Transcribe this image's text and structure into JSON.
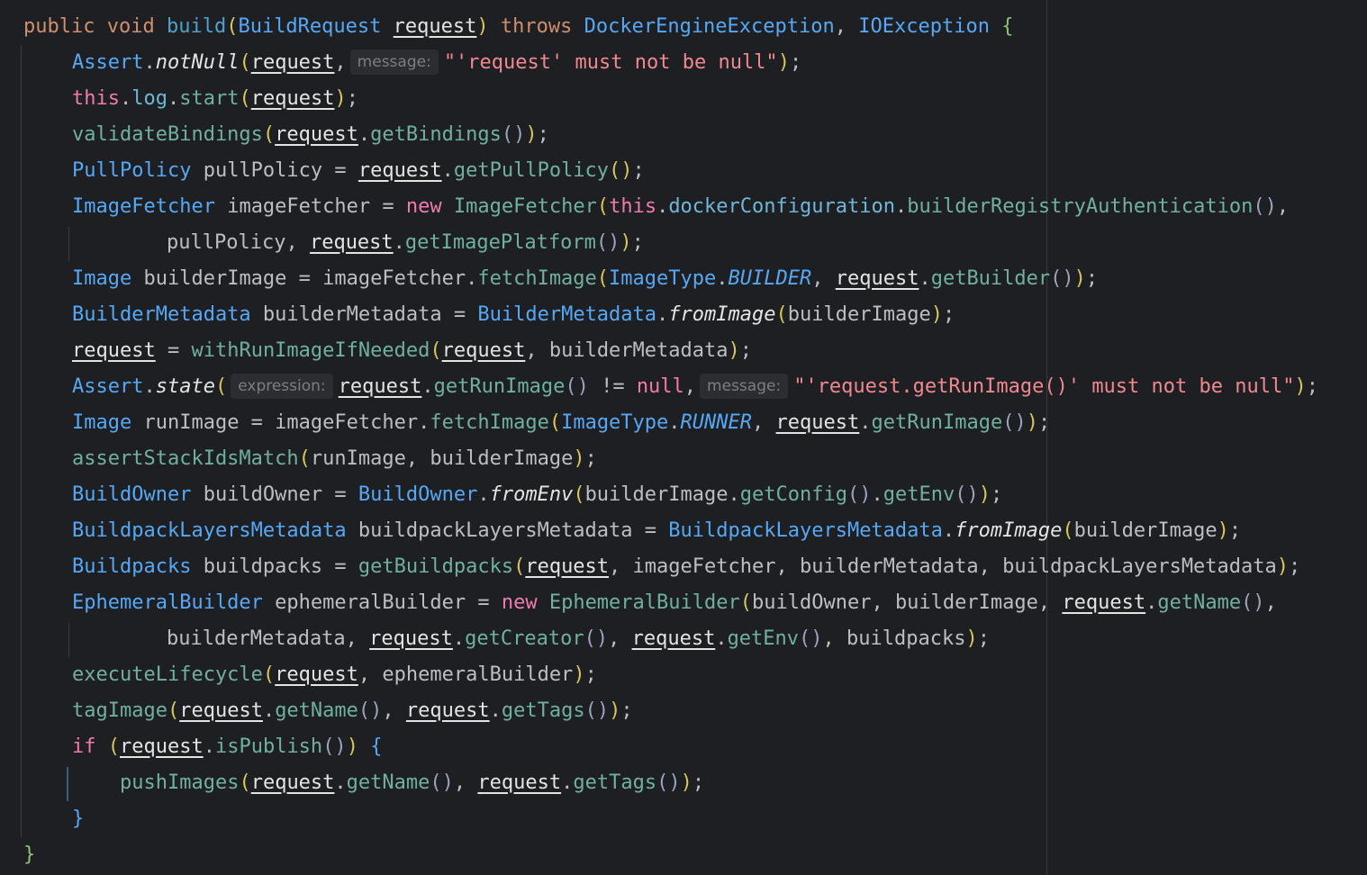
{
  "editor": {
    "lines": [
      [
        {
          "t": "public",
          "c": "kw"
        },
        {
          "t": " ",
          "c": "punc"
        },
        {
          "t": "void",
          "c": "kw"
        },
        {
          "t": " ",
          "c": "punc"
        },
        {
          "t": "build",
          "c": "mdecl"
        },
        {
          "t": "(",
          "c": "paren"
        },
        {
          "t": "BuildRequest",
          "c": "type"
        },
        {
          "t": " ",
          "c": "punc"
        },
        {
          "t": "request",
          "c": "param"
        },
        {
          "t": ")",
          "c": "paren"
        },
        {
          "t": " ",
          "c": "punc"
        },
        {
          "t": "throws",
          "c": "kw"
        },
        {
          "t": " ",
          "c": "punc"
        },
        {
          "t": "DockerEngineException",
          "c": "type"
        },
        {
          "t": ", ",
          "c": "punc"
        },
        {
          "t": "IOException",
          "c": "type"
        },
        {
          "t": " ",
          "c": "punc"
        },
        {
          "t": "{",
          "c": "brace2"
        }
      ],
      [
        {
          "t": "Assert",
          "c": "type"
        },
        {
          "t": ".",
          "c": "punc"
        },
        {
          "t": "notNull",
          "c": "smeth"
        },
        {
          "t": "(",
          "c": "paren"
        },
        {
          "t": "request",
          "c": "param"
        },
        {
          "t": ",",
          "c": "punc"
        },
        {
          "t": "message:",
          "c": "hint"
        },
        {
          "t": "\"'request' must not be null\"",
          "c": "str"
        },
        {
          "t": ")",
          "c": "paren"
        },
        {
          "t": ";",
          "c": "punc"
        }
      ],
      [
        {
          "t": "this",
          "c": "pkw"
        },
        {
          "t": ".",
          "c": "punc"
        },
        {
          "t": "log",
          "c": "field"
        },
        {
          "t": ".",
          "c": "punc"
        },
        {
          "t": "start",
          "c": "meth"
        },
        {
          "t": "(",
          "c": "paren"
        },
        {
          "t": "request",
          "c": "param"
        },
        {
          "t": ")",
          "c": "paren"
        },
        {
          "t": ";",
          "c": "punc"
        }
      ],
      [
        {
          "t": "validateBindings",
          "c": "meth"
        },
        {
          "t": "(",
          "c": "paren"
        },
        {
          "t": "request",
          "c": "param"
        },
        {
          "t": ".",
          "c": "punc"
        },
        {
          "t": "getBindings",
          "c": "meth"
        },
        {
          "t": "()",
          "c": "paren2"
        },
        {
          "t": ")",
          "c": "paren"
        },
        {
          "t": ";",
          "c": "punc"
        }
      ],
      [
        {
          "t": "PullPolicy",
          "c": "type"
        },
        {
          "t": " pullPolicy = ",
          "c": "var"
        },
        {
          "t": "request",
          "c": "param"
        },
        {
          "t": ".",
          "c": "punc"
        },
        {
          "t": "getPullPolicy",
          "c": "meth"
        },
        {
          "t": "()",
          "c": "paren"
        },
        {
          "t": ";",
          "c": "punc"
        }
      ],
      [
        {
          "t": "ImageFetcher",
          "c": "type"
        },
        {
          "t": " imageFetcher = ",
          "c": "var"
        },
        {
          "t": "new",
          "c": "pkw"
        },
        {
          "t": " ",
          "c": "punc"
        },
        {
          "t": "ImageFetcher",
          "c": "meth"
        },
        {
          "t": "(",
          "c": "paren"
        },
        {
          "t": "this",
          "c": "pkw"
        },
        {
          "t": ".",
          "c": "punc"
        },
        {
          "t": "dockerConfiguration",
          "c": "field"
        },
        {
          "t": ".",
          "c": "punc"
        },
        {
          "t": "builderRegistryAuthentication",
          "c": "meth"
        },
        {
          "t": "()",
          "c": "paren2"
        },
        {
          "t": ",",
          "c": "punc"
        }
      ],
      [
        {
          "t": "pullPolicy, ",
          "c": "var"
        },
        {
          "t": "request",
          "c": "param"
        },
        {
          "t": ".",
          "c": "punc"
        },
        {
          "t": "getImagePlatform",
          "c": "meth"
        },
        {
          "t": "()",
          "c": "paren2"
        },
        {
          "t": ")",
          "c": "paren"
        },
        {
          "t": ";",
          "c": "punc"
        }
      ],
      [
        {
          "t": "Image",
          "c": "type"
        },
        {
          "t": " builderImage = imageFetcher.",
          "c": "var"
        },
        {
          "t": "fetchImage",
          "c": "meth"
        },
        {
          "t": "(",
          "c": "paren"
        },
        {
          "t": "ImageType",
          "c": "type"
        },
        {
          "t": ".",
          "c": "punc"
        },
        {
          "t": "BUILDER",
          "c": "static"
        },
        {
          "t": ", ",
          "c": "punc"
        },
        {
          "t": "request",
          "c": "param"
        },
        {
          "t": ".",
          "c": "punc"
        },
        {
          "t": "getBuilder",
          "c": "meth"
        },
        {
          "t": "()",
          "c": "paren2"
        },
        {
          "t": ")",
          "c": "paren"
        },
        {
          "t": ";",
          "c": "punc"
        }
      ],
      [
        {
          "t": "BuilderMetadata",
          "c": "type"
        },
        {
          "t": " builderMetadata = ",
          "c": "var"
        },
        {
          "t": "BuilderMetadata",
          "c": "type"
        },
        {
          "t": ".",
          "c": "punc"
        },
        {
          "t": "fromImage",
          "c": "smeth"
        },
        {
          "t": "(",
          "c": "paren"
        },
        {
          "t": "builderImage",
          "c": "var"
        },
        {
          "t": ")",
          "c": "paren"
        },
        {
          "t": ";",
          "c": "punc"
        }
      ],
      [
        {
          "t": "request",
          "c": "param"
        },
        {
          "t": " = ",
          "c": "var"
        },
        {
          "t": "withRunImageIfNeeded",
          "c": "meth"
        },
        {
          "t": "(",
          "c": "paren"
        },
        {
          "t": "request",
          "c": "param"
        },
        {
          "t": ", builderMetadata",
          "c": "var"
        },
        {
          "t": ")",
          "c": "paren"
        },
        {
          "t": ";",
          "c": "punc"
        }
      ],
      [
        {
          "t": "Assert",
          "c": "type"
        },
        {
          "t": ".",
          "c": "punc"
        },
        {
          "t": "state",
          "c": "smeth"
        },
        {
          "t": "(",
          "c": "paren"
        },
        {
          "t": "expression:",
          "c": "hint"
        },
        {
          "t": "request",
          "c": "param"
        },
        {
          "t": ".",
          "c": "punc"
        },
        {
          "t": "getRunImage",
          "c": "meth"
        },
        {
          "t": "()",
          "c": "paren2"
        },
        {
          "t": " != ",
          "c": "var"
        },
        {
          "t": "null",
          "c": "pkw"
        },
        {
          "t": ",",
          "c": "punc"
        },
        {
          "t": "message:",
          "c": "hint"
        },
        {
          "t": "\"'request.getRunImage()' must not be null\"",
          "c": "str"
        },
        {
          "t": ")",
          "c": "paren"
        },
        {
          "t": ";",
          "c": "punc"
        }
      ],
      [
        {
          "t": "Image",
          "c": "type"
        },
        {
          "t": " runImage = imageFetcher.",
          "c": "var"
        },
        {
          "t": "fetchImage",
          "c": "meth"
        },
        {
          "t": "(",
          "c": "paren"
        },
        {
          "t": "ImageType",
          "c": "type"
        },
        {
          "t": ".",
          "c": "punc"
        },
        {
          "t": "RUNNER",
          "c": "static"
        },
        {
          "t": ", ",
          "c": "punc"
        },
        {
          "t": "request",
          "c": "param"
        },
        {
          "t": ".",
          "c": "punc"
        },
        {
          "t": "getRunImage",
          "c": "meth"
        },
        {
          "t": "()",
          "c": "paren2"
        },
        {
          "t": ")",
          "c": "paren"
        },
        {
          "t": ";",
          "c": "punc"
        }
      ],
      [
        {
          "t": "assertStackIdsMatch",
          "c": "meth"
        },
        {
          "t": "(",
          "c": "paren"
        },
        {
          "t": "runImage, builderImage",
          "c": "var"
        },
        {
          "t": ")",
          "c": "paren"
        },
        {
          "t": ";",
          "c": "punc"
        }
      ],
      [
        {
          "t": "BuildOwner",
          "c": "type"
        },
        {
          "t": " buildOwner = ",
          "c": "var"
        },
        {
          "t": "BuildOwner",
          "c": "type"
        },
        {
          "t": ".",
          "c": "punc"
        },
        {
          "t": "fromEnv",
          "c": "smeth"
        },
        {
          "t": "(",
          "c": "paren"
        },
        {
          "t": "builderImage.",
          "c": "var"
        },
        {
          "t": "getConfig",
          "c": "meth"
        },
        {
          "t": "()",
          "c": "paren2"
        },
        {
          "t": ".",
          "c": "punc"
        },
        {
          "t": "getEnv",
          "c": "meth"
        },
        {
          "t": "()",
          "c": "paren2"
        },
        {
          "t": ")",
          "c": "paren"
        },
        {
          "t": ";",
          "c": "punc"
        }
      ],
      [
        {
          "t": "BuildpackLayersMetadata",
          "c": "type"
        },
        {
          "t": " buildpackLayersMetadata = ",
          "c": "var"
        },
        {
          "t": "BuildpackLayersMetadata",
          "c": "type"
        },
        {
          "t": ".",
          "c": "punc"
        },
        {
          "t": "fromImage",
          "c": "smeth"
        },
        {
          "t": "(",
          "c": "paren"
        },
        {
          "t": "builderImage",
          "c": "var"
        },
        {
          "t": ")",
          "c": "paren"
        },
        {
          "t": ";",
          "c": "punc"
        }
      ],
      [
        {
          "t": "Buildpacks",
          "c": "type"
        },
        {
          "t": " buildpacks = ",
          "c": "var"
        },
        {
          "t": "getBuildpacks",
          "c": "meth"
        },
        {
          "t": "(",
          "c": "paren"
        },
        {
          "t": "request",
          "c": "param"
        },
        {
          "t": ", imageFetcher, builderMetadata, buildpackLayersMetadata",
          "c": "var"
        },
        {
          "t": ")",
          "c": "paren"
        },
        {
          "t": ";",
          "c": "punc"
        }
      ],
      [
        {
          "t": "EphemeralBuilder",
          "c": "type"
        },
        {
          "t": " ephemeralBuilder = ",
          "c": "var"
        },
        {
          "t": "new",
          "c": "pkw"
        },
        {
          "t": " ",
          "c": "punc"
        },
        {
          "t": "EphemeralBuilder",
          "c": "meth"
        },
        {
          "t": "(",
          "c": "paren"
        },
        {
          "t": "buildOwner, builderImage, ",
          "c": "var"
        },
        {
          "t": "request",
          "c": "param"
        },
        {
          "t": ".",
          "c": "punc"
        },
        {
          "t": "getName",
          "c": "meth"
        },
        {
          "t": "()",
          "c": "paren2"
        },
        {
          "t": ",",
          "c": "punc"
        }
      ],
      [
        {
          "t": "builderMetadata, ",
          "c": "var"
        },
        {
          "t": "request",
          "c": "param"
        },
        {
          "t": ".",
          "c": "punc"
        },
        {
          "t": "getCreator",
          "c": "meth"
        },
        {
          "t": "()",
          "c": "paren2"
        },
        {
          "t": ", ",
          "c": "punc"
        },
        {
          "t": "request",
          "c": "param"
        },
        {
          "t": ".",
          "c": "punc"
        },
        {
          "t": "getEnv",
          "c": "meth"
        },
        {
          "t": "()",
          "c": "paren2"
        },
        {
          "t": ", buildpacks",
          "c": "var"
        },
        {
          "t": ")",
          "c": "paren"
        },
        {
          "t": ";",
          "c": "punc"
        }
      ],
      [
        {
          "t": "executeLifecycle",
          "c": "meth"
        },
        {
          "t": "(",
          "c": "paren"
        },
        {
          "t": "request",
          "c": "param"
        },
        {
          "t": ", ephemeralBuilder",
          "c": "var"
        },
        {
          "t": ")",
          "c": "paren"
        },
        {
          "t": ";",
          "c": "punc"
        }
      ],
      [
        {
          "t": "tagImage",
          "c": "meth"
        },
        {
          "t": "(",
          "c": "paren"
        },
        {
          "t": "request",
          "c": "param"
        },
        {
          "t": ".",
          "c": "punc"
        },
        {
          "t": "getName",
          "c": "meth"
        },
        {
          "t": "()",
          "c": "paren2"
        },
        {
          "t": ", ",
          "c": "punc"
        },
        {
          "t": "request",
          "c": "param"
        },
        {
          "t": ".",
          "c": "punc"
        },
        {
          "t": "getTags",
          "c": "meth"
        },
        {
          "t": "()",
          "c": "paren2"
        },
        {
          "t": ")",
          "c": "paren"
        },
        {
          "t": ";",
          "c": "punc"
        }
      ],
      [
        {
          "t": "if",
          "c": "pkw"
        },
        {
          "t": " ",
          "c": "punc"
        },
        {
          "t": "(",
          "c": "paren"
        },
        {
          "t": "request",
          "c": "param"
        },
        {
          "t": ".",
          "c": "punc"
        },
        {
          "t": "isPublish",
          "c": "meth"
        },
        {
          "t": "()",
          "c": "paren2"
        },
        {
          "t": ")",
          "c": "paren"
        },
        {
          "t": " ",
          "c": "punc"
        },
        {
          "t": "{",
          "c": "brace"
        }
      ],
      [
        {
          "t": "pushImages",
          "c": "meth"
        },
        {
          "t": "(",
          "c": "paren"
        },
        {
          "t": "request",
          "c": "param"
        },
        {
          "t": ".",
          "c": "punc"
        },
        {
          "t": "getName",
          "c": "meth"
        },
        {
          "t": "()",
          "c": "paren2"
        },
        {
          "t": ", ",
          "c": "punc"
        },
        {
          "t": "request",
          "c": "param"
        },
        {
          "t": ".",
          "c": "punc"
        },
        {
          "t": "getTags",
          "c": "meth"
        },
        {
          "t": "()",
          "c": "paren2"
        },
        {
          "t": ")",
          "c": "paren"
        },
        {
          "t": ";",
          "c": "punc"
        }
      ],
      [
        {
          "t": "}",
          "c": "brace"
        }
      ],
      [
        {
          "t": "}",
          "c": "brace2"
        }
      ]
    ]
  }
}
